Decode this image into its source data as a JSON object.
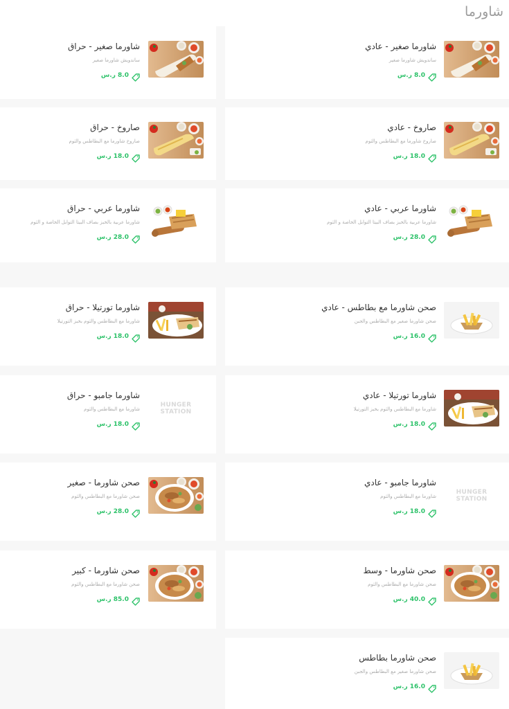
{
  "section": {
    "title": "شاورما"
  },
  "currency_note": "prices shown as 'X.0 ر.س'",
  "colors": {
    "price": "#2ec26a",
    "title": "#9b9b9b",
    "name": "#333333",
    "desc": "#aaaaaa"
  },
  "items": [
    {
      "name": "شاورما صغير - عادي",
      "desc": "ساندويش شاورما صغير",
      "price": "8.0 ر.س",
      "image": "wrap"
    },
    {
      "name": "شاورما صغير - حراق",
      "desc": "ساندويش شاورما صغير",
      "price": "8.0 ر.س",
      "image": "wrap"
    },
    {
      "name": "صاروخ - عادي",
      "desc": "صاروخ شاورما مع البطاطس والثوم",
      "price": "18.0 ر.س",
      "image": "rocket"
    },
    {
      "name": "صاروخ - حراق",
      "desc": "صاروخ شاورما مع البطاطس والثوم",
      "price": "18.0 ر.س",
      "image": "rocket"
    },
    {
      "name": "شاورما عربي - عادي",
      "desc": "شاورما عربية بالخبز بصاف البيتا التوابل الخاصة و الثوم",
      "price": "28.0 ر.س",
      "image": "arabi"
    },
    {
      "name": "شاورما عربي - حراق",
      "desc": "شاورما عربية بالخبز بصاف البيتا التوابل الخاصة و الثوم",
      "price": "28.0 ر.س",
      "image": "arabi"
    },
    {
      "name": "صحن شاورما مع بطاطس - عادي",
      "desc": "صحن شاورما صغير مع البطاطس والجبن",
      "price": "16.0 ر.س",
      "image": "fries"
    },
    {
      "name": "شاورما تورتيلا - حراق",
      "desc": "شاورما مع البطاطس والثوم بخبز التورتيلا",
      "price": "18.0 ر.س",
      "image": "tortilla"
    },
    {
      "name": "شاورما تورتيلا - عادي",
      "desc": "شاورما مع البطاطس والثوم بخبز التورتيلا",
      "price": "18.0 ر.س",
      "image": "tortilla"
    },
    {
      "name": "شاورما جامبو - حراق",
      "desc": "شاورما مع البطاطس والثوم",
      "price": "18.0 ر.س",
      "image": "logo"
    },
    {
      "name": "شاورما جامبو - عادي",
      "desc": "شاورما مع البطاطس والثوم",
      "price": "18.0 ر.س",
      "image": "logo"
    },
    {
      "name": "صحن شاورما - صغير",
      "desc": "صحن شاورما مع البطاطس والثوم",
      "price": "28.0 ر.س",
      "image": "plate"
    },
    {
      "name": "صحن شاورما - وسط",
      "desc": "صحن شاورما مع البطاطس والثوم",
      "price": "40.0 ر.س",
      "image": "plate"
    },
    {
      "name": "صحن شاورما - كبير",
      "desc": "صحن شاورما مع البطاطس والثوم",
      "price": "85.0 ر.س",
      "image": "plate"
    },
    {
      "name": "صحن شاورما بطاطس",
      "desc": "صحن شاورما صغير مع البطاطس والجبن",
      "price": "16.0 ر.س",
      "image": "fries"
    }
  ],
  "logo_text": {
    "line1": "HUNGER",
    "line2": "STATION"
  }
}
